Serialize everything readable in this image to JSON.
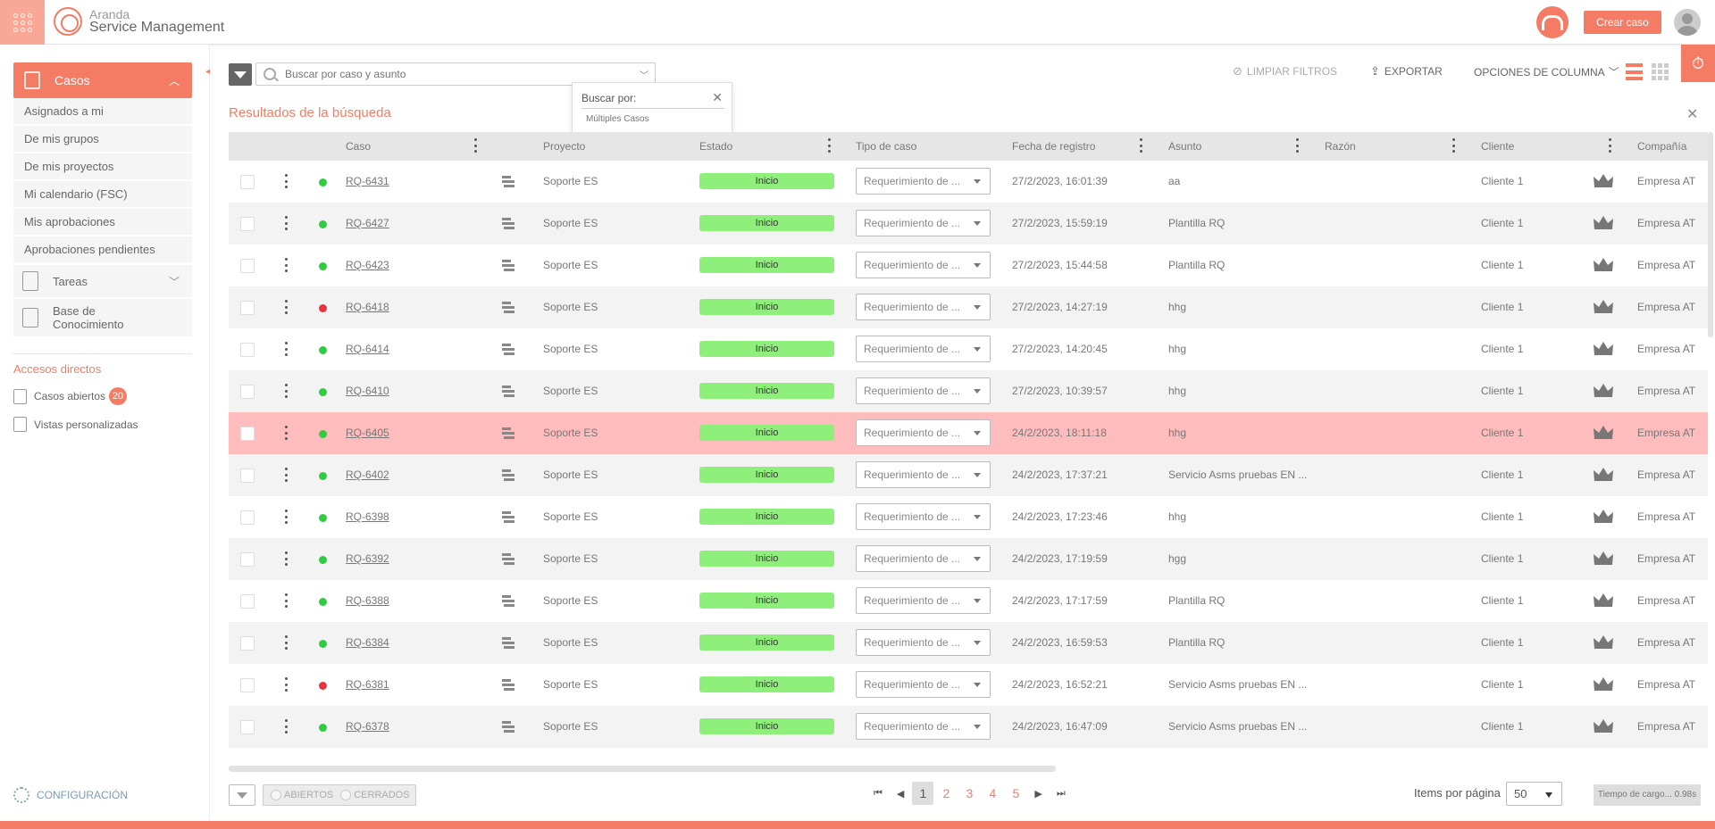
{
  "header": {
    "logo_line1": "Aranda",
    "logo_line2": "Service Management",
    "create_case": "Crear caso"
  },
  "sidebar": {
    "cases_label": "Casos",
    "case_items": [
      "Asignados a mi",
      "De mis grupos",
      "De mis proyectos",
      "Mi calendario (FSC)",
      "Mis aprobaciones",
      "Aprobaciones pendientes"
    ],
    "tasks_label": "Tareas",
    "kb_label_1": "Base de",
    "kb_label_2": "Conocimiento",
    "shortcuts_title": "Accesos directos",
    "open_cases": "Casos abiertos",
    "open_cases_count": "20",
    "custom_views": "Vistas personalizadas",
    "config": "CONFIGURACIÓN"
  },
  "search": {
    "placeholder": "Buscar por caso y asunto",
    "popup_title": "Buscar por:",
    "popup_option": "Múltiples Casos"
  },
  "toolbar": {
    "clear_filters": "LIMPIAR FILTROS",
    "export": "EXPORTAR",
    "column_options": "OPCIONES DE COLUMNA"
  },
  "results_title": "Resultados de la búsqueda",
  "columns": [
    "Caso",
    "Proyecto",
    "Estado",
    "Tipo de caso",
    "Fecha de registro",
    "Asunto",
    "Razón",
    "Cliente",
    "Compañía"
  ],
  "colors": {
    "accent": "#f47c64",
    "status_green": "#2ecc40",
    "status_red": "#e8343f",
    "status_pill": "#8ef07a",
    "highlight_row": "#ffbcbc"
  },
  "rows": [
    {
      "id": "RQ-6431",
      "dot": "green",
      "project": "Soporte ES",
      "status": "Inicio",
      "type": "Requerimiento de ...",
      "date": "27/2/2023, 16:01:39",
      "subject": "aa",
      "client": "Cliente 1",
      "company": "Empresa AT"
    },
    {
      "id": "RQ-6427",
      "dot": "green",
      "project": "Soporte ES",
      "status": "Inicio",
      "type": "Requerimiento de ...",
      "date": "27/2/2023, 15:59:19",
      "subject": "Plantilla RQ",
      "client": "Cliente 1",
      "company": "Empresa AT"
    },
    {
      "id": "RQ-6423",
      "dot": "green",
      "project": "Soporte ES",
      "status": "Inicio",
      "type": "Requerimiento de ...",
      "date": "27/2/2023, 15:44:58",
      "subject": "Plantilla RQ",
      "client": "Cliente 1",
      "company": "Empresa AT"
    },
    {
      "id": "RQ-6418",
      "dot": "red",
      "project": "Soporte ES",
      "status": "Inicio",
      "type": "Requerimiento de ...",
      "date": "27/2/2023, 14:27:19",
      "subject": "hhg",
      "client": "Cliente 1",
      "company": "Empresa AT"
    },
    {
      "id": "RQ-6414",
      "dot": "green",
      "project": "Soporte ES",
      "status": "Inicio",
      "type": "Requerimiento de ...",
      "date": "27/2/2023, 14:20:45",
      "subject": "hhg",
      "client": "Cliente 1",
      "company": "Empresa AT"
    },
    {
      "id": "RQ-6410",
      "dot": "green",
      "project": "Soporte ES",
      "status": "Inicio",
      "type": "Requerimiento de ...",
      "date": "27/2/2023, 10:39:57",
      "subject": "hhg",
      "client": "Cliente 1",
      "company": "Empresa AT"
    },
    {
      "id": "RQ-6405",
      "dot": "green",
      "project": "Soporte ES",
      "status": "Inicio",
      "type": "Requerimiento de ...",
      "date": "24/2/2023, 18:11:18",
      "subject": "hhg",
      "client": "Cliente 1",
      "company": "Empresa AT",
      "highlight": true
    },
    {
      "id": "RQ-6402",
      "dot": "green",
      "project": "Soporte ES",
      "status": "Inicio",
      "type": "Requerimiento de ...",
      "date": "24/2/2023, 17:37:21",
      "subject": "Servicio Asms pruebas EN ...",
      "client": "Cliente 1",
      "company": "Empresa AT"
    },
    {
      "id": "RQ-6398",
      "dot": "green",
      "project": "Soporte ES",
      "status": "Inicio",
      "type": "Requerimiento de ...",
      "date": "24/2/2023, 17:23:46",
      "subject": "hhg",
      "client": "Cliente 1",
      "company": "Empresa AT"
    },
    {
      "id": "RQ-6392",
      "dot": "green",
      "project": "Soporte ES",
      "status": "Inicio",
      "type": "Requerimiento de ...",
      "date": "24/2/2023, 17:19:59",
      "subject": "hgg",
      "client": "Cliente 1",
      "company": "Empresa AT"
    },
    {
      "id": "RQ-6388",
      "dot": "green",
      "project": "Soporte ES",
      "status": "Inicio",
      "type": "Requerimiento de ...",
      "date": "24/2/2023, 17:17:59",
      "subject": "Plantilla RQ",
      "client": "Cliente 1",
      "company": "Empresa AT"
    },
    {
      "id": "RQ-6384",
      "dot": "green",
      "project": "Soporte ES",
      "status": "Inicio",
      "type": "Requerimiento de ...",
      "date": "24/2/2023, 16:59:53",
      "subject": "Plantilla RQ",
      "client": "Cliente 1",
      "company": "Empresa AT"
    },
    {
      "id": "RQ-6381",
      "dot": "red",
      "project": "Soporte ES",
      "status": "Inicio",
      "type": "Requerimiento de ...",
      "date": "24/2/2023, 16:52:21",
      "subject": "Servicio Asms pruebas EN ...",
      "client": "Cliente 1",
      "company": "Empresa AT"
    },
    {
      "id": "RQ-6378",
      "dot": "green",
      "project": "Soporte ES",
      "status": "Inicio",
      "type": "Requerimiento de ...",
      "date": "24/2/2023, 16:47:09",
      "subject": "Servicio Asms pruebas EN ...",
      "client": "Cliente 1",
      "company": "Empresa AT"
    }
  ],
  "footer": {
    "open_label": "ABIERTOS",
    "closed_label": "CERRADOS",
    "pages": [
      "1",
      "2",
      "3",
      "4",
      "5"
    ],
    "current_page": "1",
    "items_per_page_label": "Items por página",
    "items_per_page": "50",
    "load_time": "Tiempo de cargo... 0.98s"
  }
}
